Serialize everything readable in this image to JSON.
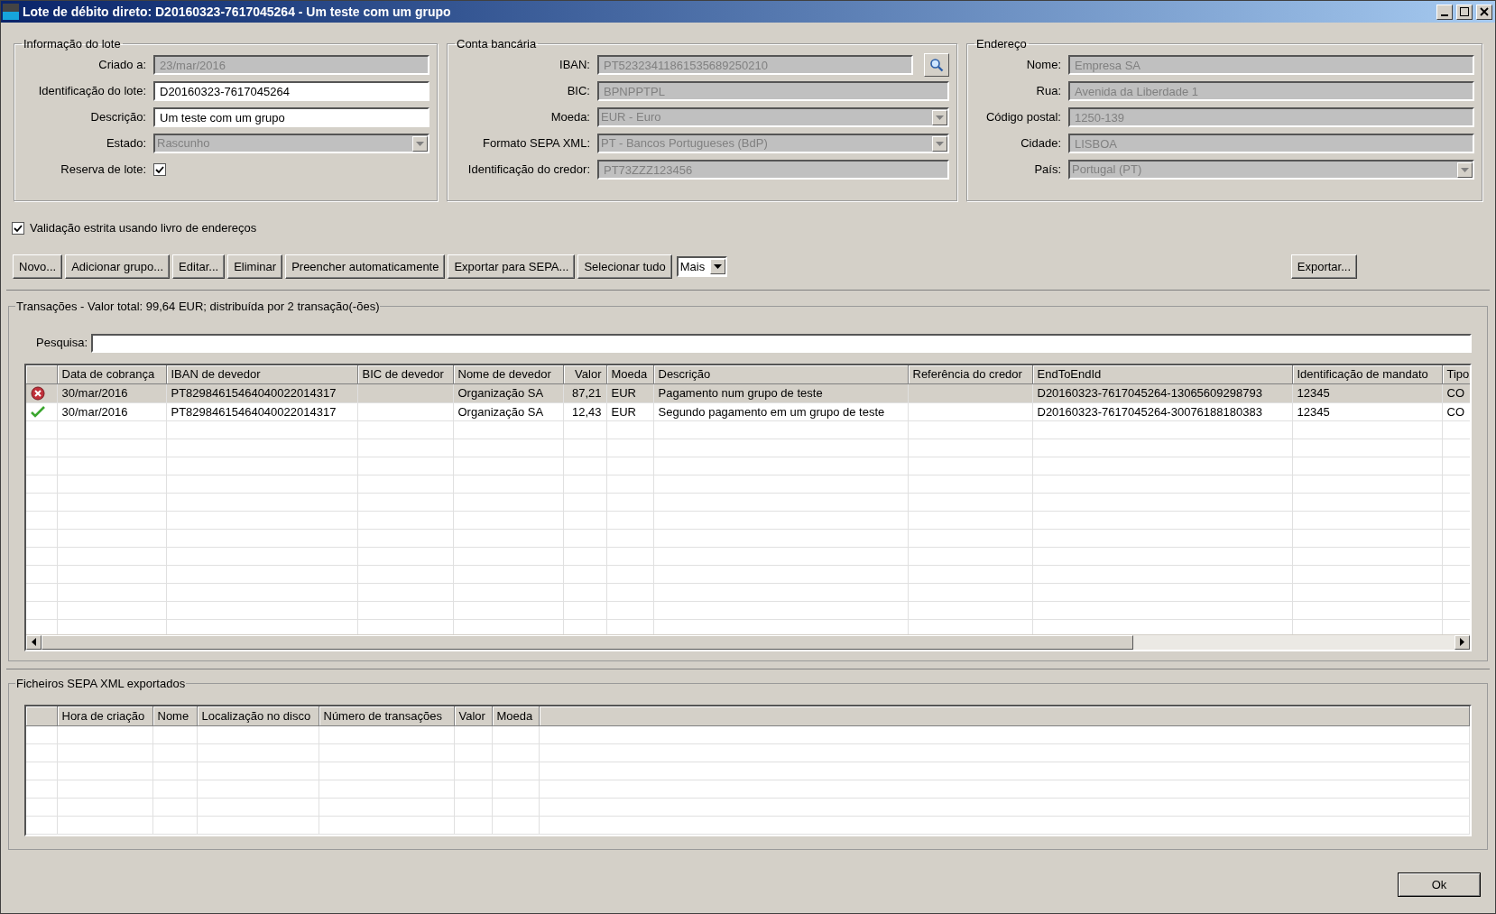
{
  "window": {
    "title": "Lote de débito direto: D20160323-7617045264 - Um teste com um grupo"
  },
  "groups": [
    {
      "title": "Informação do lote",
      "fields": [
        {
          "kind": "text",
          "label": "Criado a:",
          "value": "23/mar/2016",
          "disabled": true
        },
        {
          "kind": "text",
          "label": "Identificação do lote:",
          "value": "D20160323-7617045264",
          "disabled": false
        },
        {
          "kind": "text",
          "label": "Descrição:",
          "value": "Um teste com um grupo",
          "disabled": false
        },
        {
          "kind": "select",
          "label": "Estado:",
          "value": "Rascunho",
          "disabled": true
        },
        {
          "kind": "checkbox",
          "label": "Reserva de lote:",
          "checked": true
        }
      ]
    },
    {
      "title": "Conta bancária",
      "fields": [
        {
          "kind": "lookup",
          "label": "IBAN:",
          "value": "PT52323411861535689250210",
          "disabled": true
        },
        {
          "kind": "text",
          "label": "BIC:",
          "value": "BPNPPTPL",
          "disabled": true
        },
        {
          "kind": "select",
          "label": "Moeda:",
          "value": "EUR - Euro",
          "disabled": true
        },
        {
          "kind": "select",
          "label": "Formato SEPA XML:",
          "value": "PT - Bancos Portugueses (BdP)",
          "disabled": true
        },
        {
          "kind": "text",
          "label": "Identificação do credor:",
          "value": "PT73ZZZ123456",
          "disabled": true
        }
      ]
    },
    {
      "title": "Endereço",
      "fields": [
        {
          "kind": "text",
          "label": "Nome:",
          "value": "Empresa SA",
          "disabled": true
        },
        {
          "kind": "text",
          "label": "Rua:",
          "value": "Avenida da Liberdade 1",
          "disabled": true
        },
        {
          "kind": "text",
          "label": "Código postal:",
          "value": "1250-139",
          "disabled": true
        },
        {
          "kind": "text",
          "label": "Cidade:",
          "value": "LISBOA",
          "disabled": true
        },
        {
          "kind": "select",
          "label": "País:",
          "value": "Portugal (PT)",
          "disabled": true
        }
      ]
    }
  ],
  "strict_validation": {
    "label": "Validação estrita usando livro de endereços",
    "checked": true
  },
  "toolbar": {
    "buttons": [
      "Novo...",
      "Adicionar grupo...",
      "Editar...",
      "Eliminar",
      "Preencher automaticamente",
      "Exportar para SEPA...",
      "Selecionar tudo"
    ],
    "dropdown": "Mais",
    "export_button": "Exportar..."
  },
  "transactions": {
    "title": "Transações - Valor total: 99,64 EUR; distribuída por 2 transação(-ões)",
    "search_label": "Pesquisa:",
    "columns": [
      "Data de cobrança",
      "IBAN de devedor",
      "BIC de devedor",
      "Nome de devedor",
      "Valor",
      "Moeda",
      "Descrição",
      "Referência do credor",
      "EndToEndId",
      "Identificação de mandato",
      "Tipo"
    ],
    "rows": [
      {
        "kind": "error",
        "selected": true,
        "cells": [
          "30/mar/2016",
          "PT82984615464040022014317",
          "",
          "Organização SA",
          "87,21",
          "EUR",
          "Pagamento num grupo de teste",
          "",
          "D20160323-7617045264-13065609298793",
          "12345",
          "CO"
        ]
      },
      {
        "kind": "ok",
        "selected": false,
        "cells": [
          "30/mar/2016",
          "PT82984615464040022014317",
          "",
          "Organização SA",
          "12,43",
          "EUR",
          "Segundo pagamento em um grupo de teste",
          "",
          "D20160323-7617045264-30076188180383",
          "12345",
          "CO"
        ]
      }
    ]
  },
  "exported": {
    "title": "Ficheiros SEPA XML exportados",
    "columns": [
      "Hora de criação",
      "Nome",
      "Localização no disco",
      "Número de transações",
      "Valor",
      "Moeda"
    ]
  },
  "ok_button": "Ok"
}
